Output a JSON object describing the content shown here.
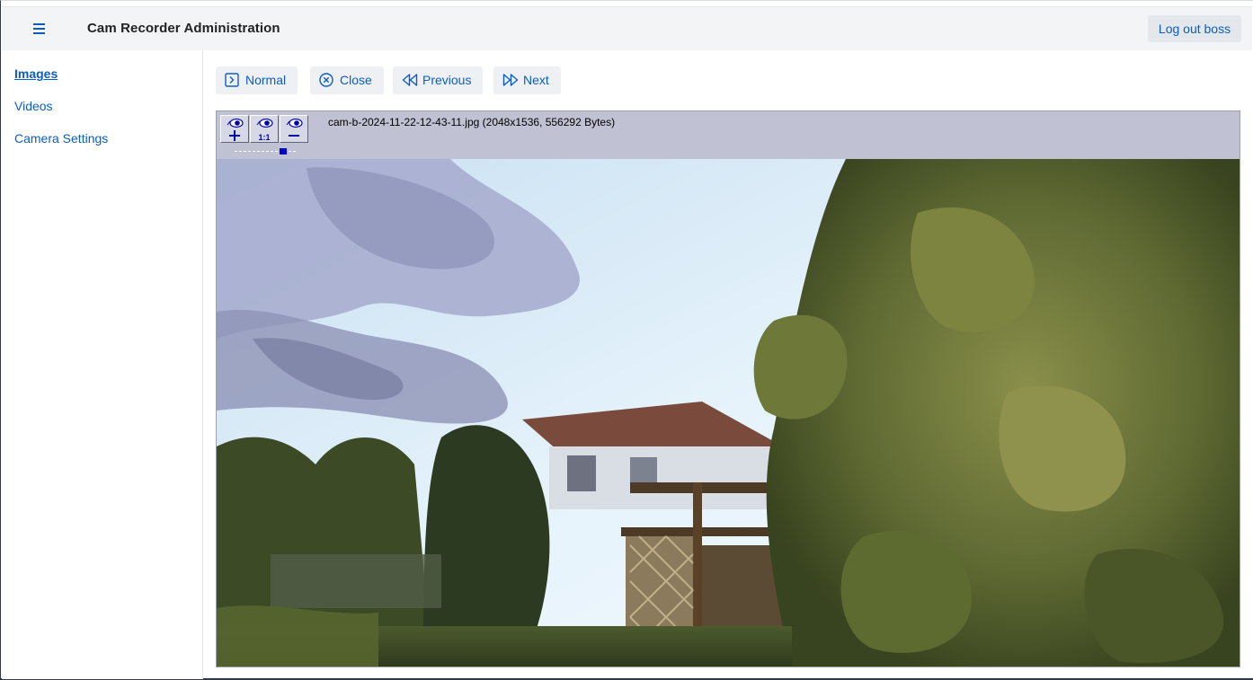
{
  "header": {
    "title": "Cam Recorder Administration",
    "menu_icon": "hamburger-menu-icon",
    "logout_label": "Log out boss"
  },
  "sidebar": {
    "items": [
      {
        "label": "Images",
        "active": true
      },
      {
        "label": "Videos",
        "active": false
      },
      {
        "label": "Camera Settings",
        "active": false
      }
    ]
  },
  "toolbar": {
    "normal_label": "Normal",
    "close_label": "Close",
    "previous_label": "Previous",
    "next_label": "Next"
  },
  "viewer": {
    "caption": "cam-b-2024-11-22-12-43-11.jpg (2048x1536, 556292 Bytes)",
    "zoom_buttons": [
      "zoom-in-icon",
      "zoom-reset-icon",
      "zoom-out-icon"
    ],
    "zoom_reset_text": "1:1"
  },
  "colors": {
    "accent": "#0a5ec2",
    "topbar_bg": "#f3f4f6",
    "viewer_bg": "#c0c1d3"
  }
}
